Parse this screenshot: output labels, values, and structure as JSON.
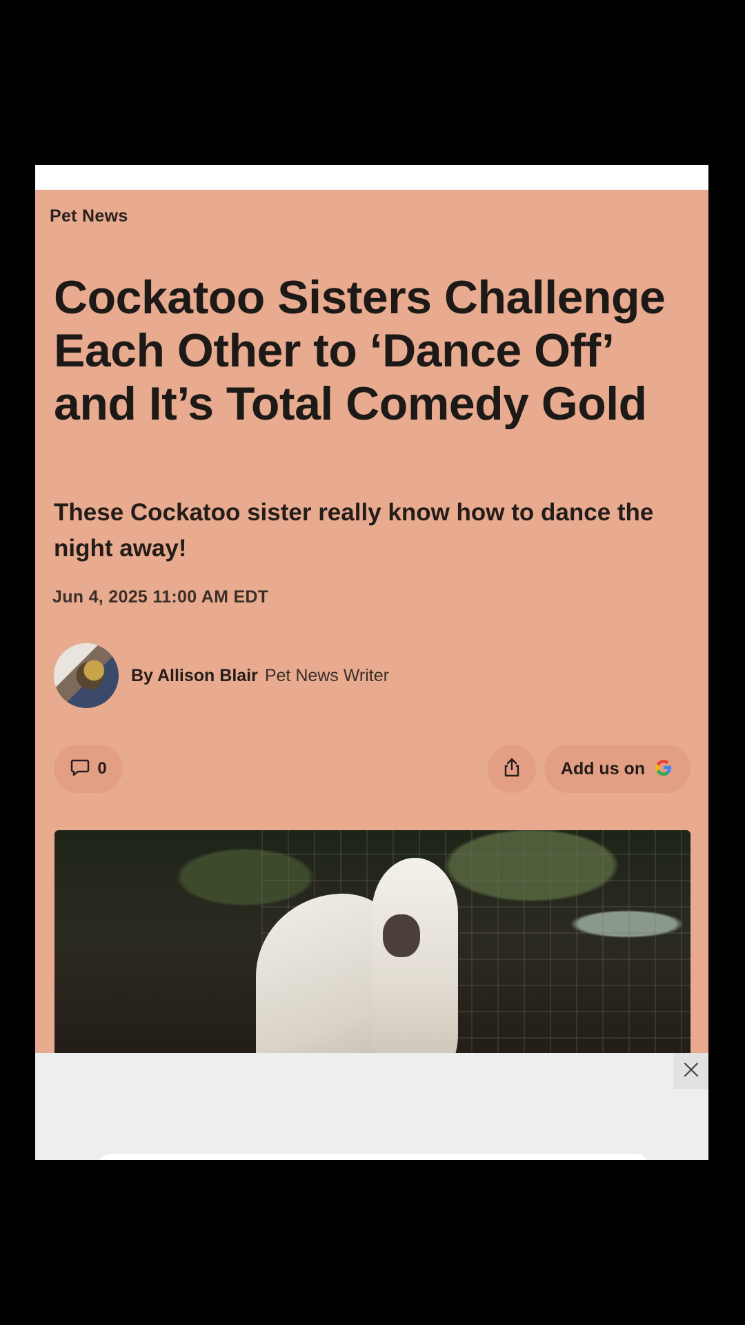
{
  "article": {
    "category": "Pet News",
    "headline": "Cockatoo Sisters Challenge Each Other to ‘Dance Off’ and It’s Total Comedy Gold",
    "subtitle": "These Cockatoo sister really know how to dance the night away!",
    "timestamp": "Jun 4, 2025 11:00 AM EDT",
    "author": {
      "name": "By Allison Blair",
      "role": "Pet News Writer"
    },
    "actions": {
      "comment_count": "0",
      "google_label": "Add us on"
    },
    "hero_image_alt": "Two white cockatoos"
  },
  "colors": {
    "background": "#e8ab8f",
    "pill": "#e29f84",
    "text": "#1d1917"
  },
  "icons": [
    "comment-icon",
    "share-icon",
    "google-icon",
    "close-icon"
  ]
}
